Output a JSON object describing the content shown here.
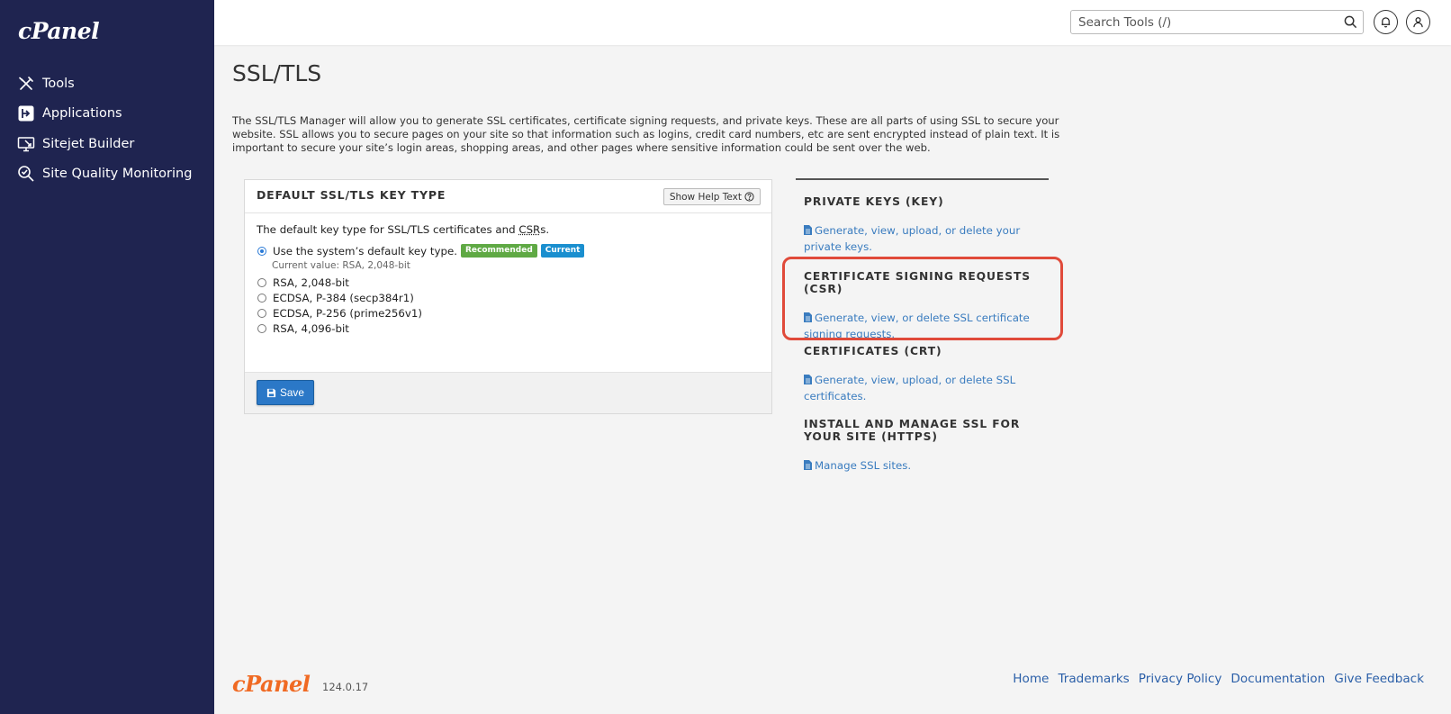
{
  "brand": {
    "logo": "cPanel",
    "footer_logo": "cPanel",
    "version": "124.0.17"
  },
  "sidebar": {
    "items": [
      {
        "label": "Tools",
        "icon": "tools-icon"
      },
      {
        "label": "Applications",
        "icon": "applications-icon"
      },
      {
        "label": "Sitejet Builder",
        "icon": "sitejet-icon"
      },
      {
        "label": "Site Quality Monitoring",
        "icon": "site-quality-icon"
      }
    ]
  },
  "header": {
    "search_placeholder": "Search Tools (/)"
  },
  "page": {
    "title": "SSL/TLS",
    "intro": "The SSL/TLS Manager will allow you to generate SSL certificates, certificate signing requests, and private keys. These are all parts of using SSL to secure your website. SSL allows you to secure pages on your site so that information such as logins, credit card numbers, etc are sent encrypted instead of plain text. It is important to secure your site’s login areas, shopping areas, and other pages where sensitive information could be sent over the web."
  },
  "key_type_panel": {
    "title": "DEFAULT SSL/TLS KEY TYPE",
    "help_button": "Show Help Text",
    "lead_prefix": "The default key type for SSL/TLS certificates and ",
    "lead_abbr": "CSR",
    "lead_suffix": "s.",
    "options": [
      {
        "label": "Use the system’s default key type.",
        "selected": true
      },
      {
        "label": "RSA, 2,048-bit",
        "selected": false
      },
      {
        "label": "ECDSA, P-384 (secp384r1)",
        "selected": false
      },
      {
        "label": "ECDSA, P-256 (prime256v1)",
        "selected": false
      },
      {
        "label": "RSA, 4,096-bit",
        "selected": false
      }
    ],
    "badge_recommended": "Recommended",
    "badge_current": "Current",
    "current_value": "Current value: RSA, 2,048-bit",
    "save_button": "Save"
  },
  "sections": [
    {
      "title": "PRIVATE KEYS (KEY)",
      "link": "Generate, view, upload, or delete your private keys."
    },
    {
      "title": "CERTIFICATE SIGNING REQUESTS (CSR)",
      "link": "Generate, view, or delete SSL certificate signing requests."
    },
    {
      "title": "CERTIFICATES (CRT)",
      "link": "Generate, view, upload, or delete SSL certificates."
    },
    {
      "title": "INSTALL AND MANAGE SSL FOR YOUR SITE (HTTPS)",
      "link": "Manage SSL sites."
    }
  ],
  "footer": {
    "links": [
      "Home",
      "Trademarks",
      "Privacy Policy",
      "Documentation",
      "Give Feedback"
    ]
  },
  "colors": {
    "sidebar_bg": "#1f2450",
    "link": "#3a7cbf",
    "save_button": "#2b78c7",
    "badge_recommended": "#5fa944",
    "badge_current": "#1a8fcf",
    "highlight": "#e04a3a",
    "brand_orange": "#f06a23"
  }
}
